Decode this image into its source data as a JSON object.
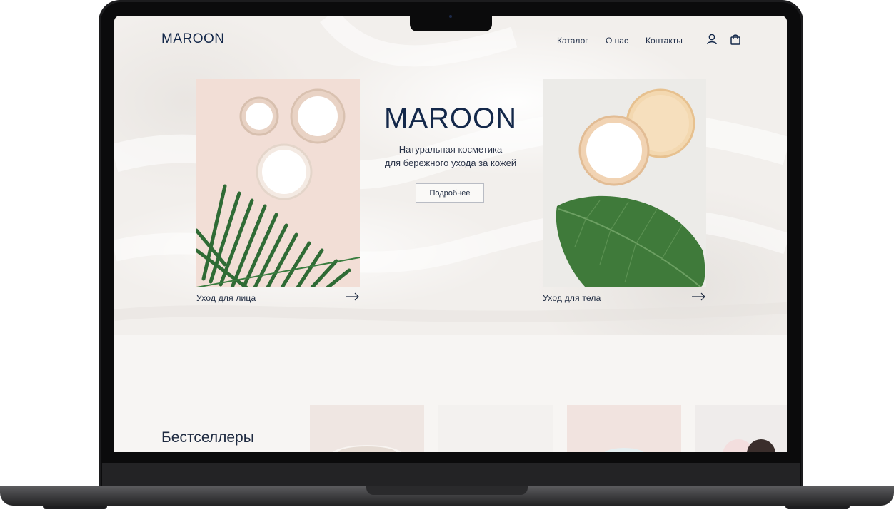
{
  "header": {
    "logo": "MAROON",
    "nav": [
      "Каталог",
      "О нас",
      "Контакты"
    ],
    "icons": [
      "user-icon",
      "bag-icon"
    ]
  },
  "hero": {
    "title": "MAROON",
    "subtitle_line1": "Натуральная косметика",
    "subtitle_line2": "для бережного ухода за кожей",
    "button": "Подробнее"
  },
  "cards": [
    {
      "label": "Уход для лица",
      "icon": "arrow-right-icon"
    },
    {
      "label": "Уход для тела",
      "icon": "arrow-right-icon"
    }
  ],
  "bestsellers": {
    "title": "Бестселлеры"
  },
  "colors": {
    "brand": "#14284a",
    "background": "#f7f5f3",
    "leaf": "#3f7a3a",
    "frame": "#1c1c1e"
  }
}
